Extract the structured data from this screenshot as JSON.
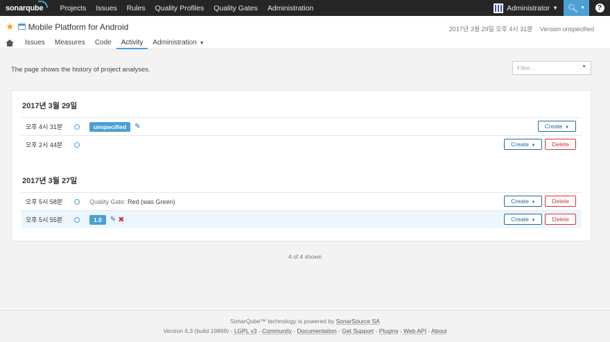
{
  "topnav": {
    "logo": "sonarqube",
    "links": [
      "Projects",
      "Issues",
      "Rules",
      "Quality Profiles",
      "Quality Gates",
      "Administration"
    ],
    "user": "Administrator",
    "help": "?"
  },
  "project": {
    "name": "Mobile Platform for Android",
    "last_analysis": "2017년 3월 29일 오후 4시 31분",
    "version": "Version unspecified",
    "tabs": [
      "Issues",
      "Measures",
      "Code",
      "Activity",
      "Administration"
    ],
    "active_tab": "Activity"
  },
  "page": {
    "description": "The page shows the history of project analyses.",
    "filter_placeholder": "Filter..."
  },
  "days": [
    {
      "date": "2017년 3월 29일",
      "analyses": [
        {
          "time": "오후 4시 31분",
          "version": "unspecified",
          "create": "Create",
          "delete": null
        },
        {
          "time": "오후 2시 44분",
          "version": null,
          "create": "Create",
          "delete": "Delete"
        }
      ]
    },
    {
      "date": "2017년 3월 27일",
      "analyses": [
        {
          "time": "오후 5시 58분",
          "qg_label": "Quality Gate:",
          "qg_value": "Red (was Green)",
          "create": "Create",
          "delete": "Delete"
        },
        {
          "time": "오후 5시 55분",
          "version": "1.0",
          "create": "Create",
          "delete": "Delete"
        }
      ]
    }
  ],
  "shown": "4 of 4 shown",
  "footer": {
    "line1_prefix": "SonarQube™ technology is powered by ",
    "line1_link": "SonarSource SA",
    "version": "Version 6.3 (build 19869)",
    "links": [
      "LGPL v3",
      "Community",
      "Documentation",
      "Get Support",
      "Plugins",
      "Web API",
      "About"
    ]
  },
  "colors": {
    "accent": "#4b9fd5",
    "danger": "#d4333f",
    "nav_bg": "#262626",
    "star": "#f4a60d"
  }
}
